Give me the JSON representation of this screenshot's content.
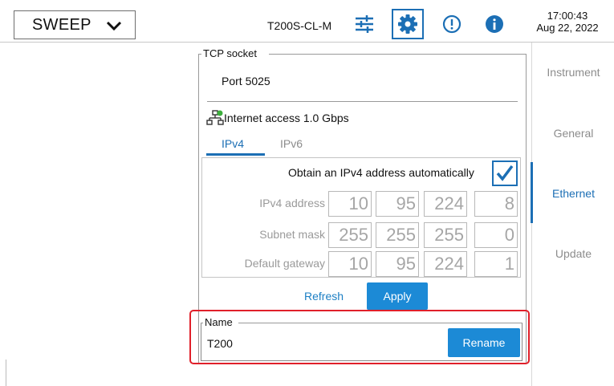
{
  "header": {
    "mode": "SWEEP",
    "device": "T200S-CL-M",
    "time": "17:00:43",
    "date": "Aug 22, 2022"
  },
  "nav": {
    "items": [
      {
        "label": "Instrument"
      },
      {
        "label": "General"
      },
      {
        "label": "Ethernet"
      },
      {
        "label": "Update"
      }
    ],
    "active": "Ethernet"
  },
  "tcp": {
    "legend": "TCP socket",
    "port": "Port 5025",
    "internet": "Internet access 1.0 Gbps"
  },
  "tabs": [
    "IPv4",
    "IPv6"
  ],
  "ipv4": {
    "auto_label": "Obtain an IPv4 address automatically",
    "auto_checked": true,
    "rows": [
      {
        "label": "IPv4 address",
        "octets": [
          "10",
          "95",
          "224",
          "8"
        ]
      },
      {
        "label": "Subnet mask",
        "octets": [
          "255",
          "255",
          "255",
          "0"
        ]
      },
      {
        "label": "Default gateway",
        "octets": [
          "10",
          "95",
          "224",
          "1"
        ]
      }
    ]
  },
  "actions": {
    "refresh": "Refresh",
    "apply": "Apply"
  },
  "name": {
    "legend": "Name",
    "value": "T200",
    "rename": "Rename"
  },
  "colors": {
    "accent": "#1c6fb5",
    "button": "#1c8ad6",
    "highlight": "#e0202a"
  },
  "icons": [
    "chevron-down-icon",
    "sliders-icon",
    "gear-icon",
    "alert-icon",
    "info-icon",
    "network-icon",
    "checkmark-icon"
  ]
}
